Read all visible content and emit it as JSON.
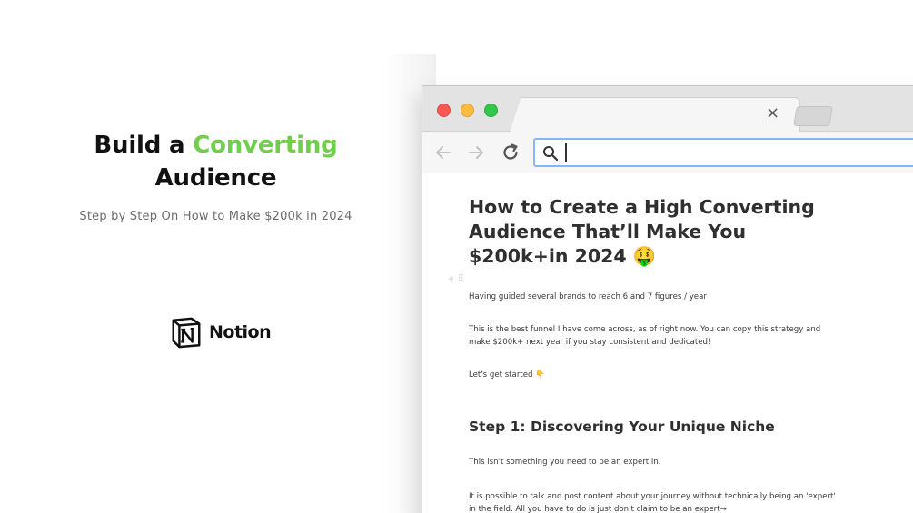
{
  "hero": {
    "title_part1": "Build a ",
    "title_accent": "Converting",
    "title_part2": "Audience",
    "subtitle": "Step by Step On How to Make $200k in 2024",
    "brand_name": "Notion",
    "accent_color": "#6fcf4a"
  },
  "browser": {
    "tab_close": "×",
    "address_placeholder": "",
    "icons": [
      "back-arrow-icon",
      "forward-arrow-icon",
      "reload-icon",
      "search-icon",
      "close-icon"
    ]
  },
  "doc": {
    "title": "How to Create a High Converting Audience That’ll Make You $200k+in 2024 🤑",
    "p1": "Having guided several brands to reach 6 and 7 figures / year",
    "p2": "This is the best funnel I have come across, as of right now. You can copy this strategy and make $200k+ next year if you stay consistent and dedicated!",
    "p3": "Let's get started 👇",
    "h2": "Step 1: Discovering Your Unique Niche",
    "p4": "This isn't something you need to be an expert in.",
    "p5": "It is possible to talk and post content about your journey without technically being an 'expert' in the field. All you have to do is just don't claim to be an expert→"
  }
}
